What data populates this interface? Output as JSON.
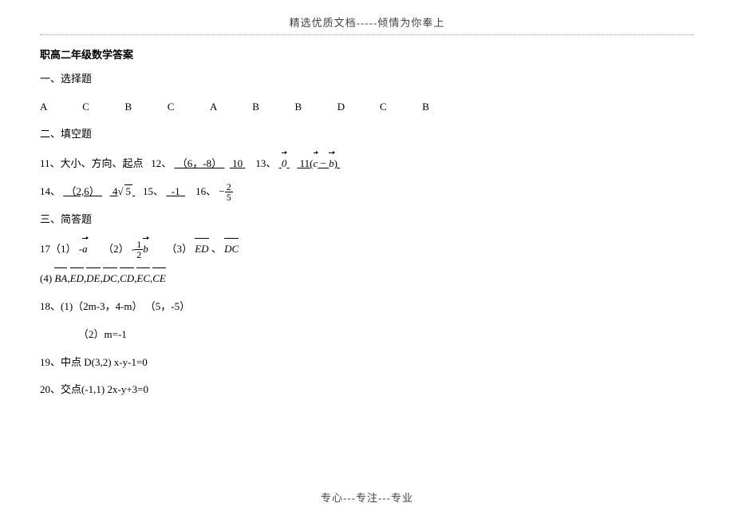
{
  "header": "精选优质文档-----倾情为你奉上",
  "title": "职高二年级数学答案",
  "sec1": {
    "label": "一、选择题",
    "choices": [
      "A",
      "C",
      "B",
      "C",
      "A",
      "B",
      "B",
      "D",
      "C",
      "B"
    ]
  },
  "sec2": {
    "label": "二、填空题",
    "q11_lead": "11、大小、方向、起点",
    "q12_lead": "12、",
    "q12_a": "（6，-8）",
    "q12_b": "10",
    "q13_lead": "13、",
    "q13_a_vec": "0",
    "q13_b_pre": "11(",
    "q13_b_vec1": "c",
    "q13_b_mid": " − ",
    "q13_b_vec2": "b",
    "q13_b_post": ")",
    "q14_lead": "14、",
    "q14_a": "（2,6）",
    "q14_b_pre": "4",
    "q14_b_rad": "5",
    "q15_lead": "15、",
    "q15_a": "-1",
    "q16_lead": "16、",
    "q16_sign": "−",
    "q16_num": "2",
    "q16_den": "5"
  },
  "sec3": {
    "label": "三、简答题",
    "q17_lead": "17（1）",
    "q17_1_pre": "-",
    "q17_1_vec": "a",
    "q17_2_lbl": "（2）",
    "q17_2_pre": "-",
    "q17_2_num": "1",
    "q17_2_den": "2",
    "q17_2_vec": "b",
    "q17_3_lbl": "（3）",
    "q17_3_v1": "ED",
    "q17_3_sep": "、",
    "q17_3_v2": "DC",
    "q17_4_lbl": "(4)",
    "q17_4_vecs": [
      "BA",
      "ED",
      "DE",
      "DC",
      "CD",
      "EC",
      "CE"
    ],
    "q18_a": "18、(1)（2m-3，4-m）      （5，-5）",
    "q18_b": "（2）m=-1",
    "q19": "19、中点 D(3,2)      x-y-1=0",
    "q20": "20、交点(-1,1)     2x-y+3=0"
  },
  "footer": "专心---专注---专业"
}
